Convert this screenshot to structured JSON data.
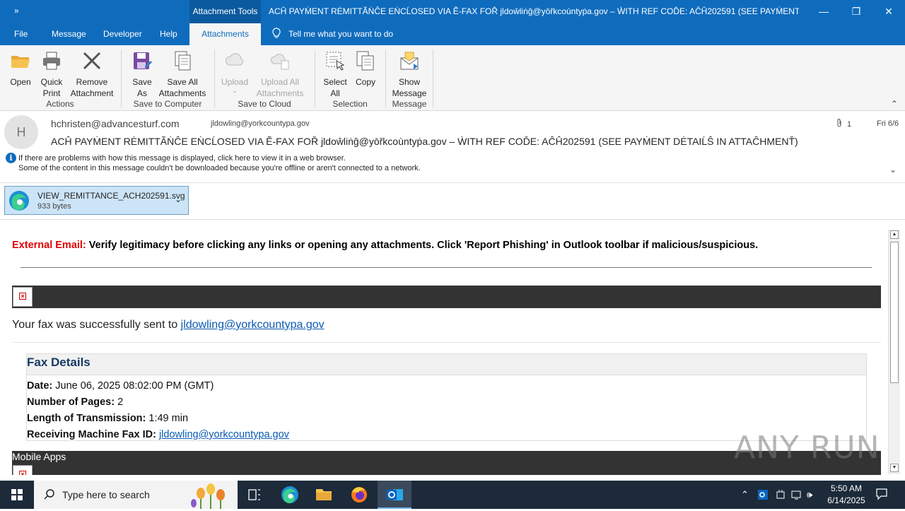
{
  "titlebar": {
    "qat": "»",
    "context_tab": "Attachment Tools",
    "title": "ACĤ PAYṀENT RĖMITTÃṄĈE EṄCĹOSED VIA Ẽ-FAX FOŘ jldoŵliṅĝ@yōřkcoùntyṗa.gov – ẀITH REF COĎE: AĈĤ202591 (SEE PAYṀENT DĖTAIĹ...",
    "min": "—",
    "max": "❐",
    "close": "✕"
  },
  "tabs": [
    "File",
    "Message",
    "Developer",
    "Help",
    "Attachments"
  ],
  "tellme": "Tell me what you want to do",
  "ribbon": {
    "open": "Open",
    "quick_print": "Quick Print",
    "remove_attachment": "Remove Attachment",
    "save_as": "Save As",
    "save_all": "Save All Attachments",
    "upload": "Upload",
    "upload_all": "Upload All Attachments",
    "select_all": "Select All",
    "copy": "Copy",
    "show_message": "Show Message",
    "groups": {
      "actions": "Actions",
      "save_to_computer": "Save to Computer",
      "save_to_cloud": "Save to Cloud",
      "selection": "Selection",
      "message": "Message"
    }
  },
  "header": {
    "avatar": "H",
    "sender": "hchristen@advancesturf.com",
    "to": "jldowling@yorkcountypa.gov",
    "subject": "ACĤ PAYṀENT RĖMITTÃṄĈE EṄCĹOSED VIA Ẽ-FAX FOŘ jldoŵliṅĝ@yōřkcoùntyṗa.gov – ẀITH REF COĎE: AĈĤ202591 (SEE PAYṀENT DĖTAIĹŜ IN ATTAĈHMENŤ)",
    "attachment_count": "1",
    "date": "Fri 6/6",
    "info_line1": "If there are problems with how this message is displayed, click here to view it in a web browser.",
    "info_line2": "Some of the content in this message couldn't be downloaded because you're offline or aren't connected to a network."
  },
  "attachment": {
    "name": "VIEW_REMITTANCE_ACH202591.svg",
    "size": "933 bytes"
  },
  "body": {
    "external_label": "External Email:",
    "external_text": " Verify legitimacy before clicking any links or opening any attachments. Click 'Report Phishing' in Outlook toolbar if malicious/suspicious.",
    "sent_text": "Your fax was successfully sent to ",
    "sent_link": "jldowling@yorkcountypa.gov",
    "fax_title": "Fax Details",
    "rows": [
      {
        "label": "Date:",
        "value": " June 06, 2025 08:02:00 PM (GMT)"
      },
      {
        "label": "Number of Pages:",
        "value": " 2"
      },
      {
        "label": "Length of Transmission:",
        "value": " 1:49 min"
      },
      {
        "label": "Receiving Machine Fax ID:",
        "value": " "
      }
    ],
    "fax_id_link": "jldowling@yorkcountypa.gov",
    "mobile_apps": "Mobile Apps"
  },
  "watermark": "ANY RUN",
  "taskbar": {
    "search_placeholder": "Type here to search",
    "time": "5:50 AM",
    "date": "6/14/2025"
  }
}
